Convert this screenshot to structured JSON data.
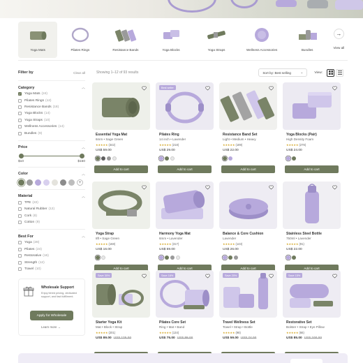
{
  "categories": [
    {
      "label": "Yoga Mats",
      "active": true
    },
    {
      "label": "Pilates Rings",
      "active": false
    },
    {
      "label": "Resistance Bands",
      "active": false
    },
    {
      "label": "Yoga Blocks",
      "active": false
    },
    {
      "label": "Yoga Straps",
      "active": false
    },
    {
      "label": "Wellness Accessories",
      "active": false
    },
    {
      "label": "Bundles",
      "active": false
    }
  ],
  "view_all_label": "View all",
  "next_icon": "arrow-right-icon",
  "sidebar": {
    "title": "Filter by",
    "clear_all": "Clear all",
    "category": {
      "title": "Category",
      "items": [
        {
          "label": "Yoga Mats",
          "count": "(24)",
          "checked": true
        },
        {
          "label": "Pilates Rings",
          "count": "(12)",
          "checked": false
        },
        {
          "label": "Resistance Bands",
          "count": "(18)",
          "checked": false
        },
        {
          "label": "Yoga Blocks",
          "count": "(14)",
          "checked": false
        },
        {
          "label": "Yoga Straps",
          "count": "(10)",
          "checked": false
        },
        {
          "label": "Wellness Accessories",
          "count": "(14)",
          "checked": false
        },
        {
          "label": "Bundles",
          "count": "(9)",
          "checked": false
        }
      ]
    },
    "price": {
      "title": "Price",
      "min": "$10",
      "max": "$150"
    },
    "color": {
      "title": "Color",
      "swatches": [
        "#6f7a5d",
        "#9e9e9e",
        "#b7a9dc",
        "#d8d0ee",
        "#e4e3dd",
        "#8c8c8c",
        "#bdbdbd"
      ]
    },
    "material": {
      "title": "Material",
      "items": [
        {
          "label": "TPE",
          "count": "(22)"
        },
        {
          "label": "Natural Rubber",
          "count": "(12)"
        },
        {
          "label": "Cork",
          "count": "(8)"
        },
        {
          "label": "Cotton",
          "count": "(9)"
        }
      ]
    },
    "best_for": {
      "title": "Best For",
      "items": [
        {
          "label": "Yoga",
          "count": "(28)"
        },
        {
          "label": "Pilates",
          "count": "(24)"
        },
        {
          "label": "Restorative",
          "count": "(16)"
        },
        {
          "label": "Strength",
          "count": "(12)"
        },
        {
          "label": "Travel",
          "count": "(10)"
        }
      ]
    },
    "wholesale": {
      "title": "Wholesale Support",
      "desc": "Enjoy tiered pricing, dedicated support, and fast fulfillment.",
      "button": "Apply for Wholesale",
      "link": "Learn more →"
    }
  },
  "toolbar": {
    "count": "Showing 1–12 of 93 results",
    "sort": "Sort by: Best selling",
    "view_label": "View:"
  },
  "products": [
    {
      "name": "Essential Yoga Mat",
      "variant": "6mm • Sage Green",
      "stars": "★★★★★",
      "reviews": "(342)",
      "price": "US$ 59.00",
      "old": "",
      "badge": "",
      "dots": [
        "#6f7a5d",
        "#5f5f5f",
        "#9a9a9a",
        "#e8e8e8"
      ],
      "cta": "Add to cart"
    },
    {
      "name": "Pilates Ring",
      "variant": "14 inch • Lavender",
      "stars": "★★★★★",
      "reviews": "(218)",
      "price": "US$ 29.00",
      "old": "",
      "badge": "Best seller",
      "dots": [
        "#b7a9dc",
        "#6f7a5d",
        "#e8e8e8"
      ],
      "cta": "Add to cart"
    },
    {
      "name": "Resistance Band Set",
      "variant": "Light • Medium • Heavy",
      "stars": "★★★★★",
      "reviews": "(189)",
      "price": "US$ 22.00",
      "old": "",
      "badge": "",
      "dots": [
        "#6f7a5d",
        "#b7a9dc"
      ],
      "cta": "Add to cart"
    },
    {
      "name": "Yoga Blocks (Pair)",
      "variant": "High Density Foam",
      "stars": "★★★★★",
      "reviews": "(276)",
      "price": "US$ 24.00",
      "old": "",
      "badge": "",
      "dots": [
        "#b7a9dc",
        "#6f7a5d"
      ],
      "cta": "Add to cart"
    },
    {
      "name": "Yoga Strap",
      "variant": "8ft • Sage Green",
      "stars": "★★★★★",
      "reviews": "(168)",
      "price": "US$ 16.00",
      "old": "",
      "badge": "",
      "dots": [
        "#6f7a5d",
        "#e8e8e8"
      ],
      "cta": "Add to cart"
    },
    {
      "name": "Harmony Yoga Mat",
      "variant": "6mm • Lavender",
      "stars": "★★★★★",
      "reviews": "(317)",
      "price": "US$ 59.00",
      "old": "",
      "badge": "",
      "dots": [
        "#b7a9dc",
        "#6f7a5d",
        "#9a9a9a",
        "#e8e8e8"
      ],
      "cta": "Add to cart"
    },
    {
      "name": "Balance & Core Cushion",
      "variant": "Lavender",
      "stars": "★★★★★",
      "reviews": "(143)",
      "price": "US$ 26.00",
      "old": "",
      "badge": "",
      "dots": [
        "#b7a9dc",
        "#6f7a5d",
        "#9a9a9a"
      ],
      "cta": "Add to cart"
    },
    {
      "name": "Stainless Steel Bottle",
      "variant": "750ml • Lavender",
      "stars": "★★★★★",
      "reviews": "(91)",
      "price": "US$ 22.00",
      "old": "",
      "badge": "",
      "dots": [
        "#b7a9dc",
        "#6f7a5d"
      ],
      "cta": "Add to cart"
    },
    {
      "name": "Starter Yoga Kit",
      "variant": "Mat • Block • Strap",
      "stars": "★★★★★",
      "reviews": "(201)",
      "price": "US$ 89.00",
      "old": "US$ 125.00",
      "badge": "Save 30%",
      "dots": [],
      "cta": "Add to cart"
    },
    {
      "name": "Pilates Core Set",
      "variant": "Ring • Mat • Band",
      "stars": "★★★★★",
      "reviews": "(134)",
      "price": "US$ 75.00",
      "old": "US$ 89.00",
      "badge": "Save 16%",
      "dots": [],
      "cta": "Add to cart"
    },
    {
      "name": "Travel Wellness Set",
      "variant": "Towel • Strap • Bottle",
      "stars": "★★★★★",
      "reviews": "(98)",
      "price": "US$ 59.00",
      "old": "US$ 74.00",
      "badge": "Save 20%",
      "dots": [],
      "cta": "Add to cart"
    },
    {
      "name": "Restorative Set",
      "variant": "Bolster • Strap • Eye Pillow",
      "stars": "★★★★★",
      "reviews": "(66)",
      "price": "US$ 85.00",
      "old": "US$ 100.00",
      "badge": "Save 15%",
      "dots": [],
      "cta": "Add to cart"
    }
  ],
  "colors": {
    "primary": "#6f7a5d",
    "lavender": "#b7a9dc",
    "badge_sale": "#b7a9dc"
  }
}
